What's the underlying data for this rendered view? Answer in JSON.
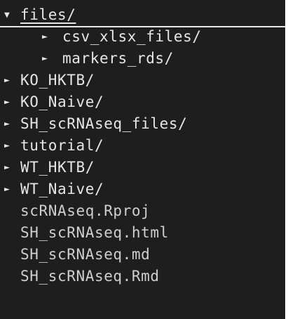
{
  "tree": {
    "root": {
      "caret": "▼",
      "label": "files/"
    },
    "subfolders": [
      {
        "caret": "►",
        "label": "csv_xlsx_files/"
      },
      {
        "caret": "►",
        "label": "markers_rds/"
      }
    ],
    "folders": [
      {
        "caret": "►",
        "label": "KO_HKTB/"
      },
      {
        "caret": "►",
        "label": "KO_Naive/"
      },
      {
        "caret": "►",
        "label": "SH_scRNAseq_files/"
      },
      {
        "caret": "►",
        "label": "tutorial/"
      },
      {
        "caret": "►",
        "label": "WT_HKTB/"
      },
      {
        "caret": "►",
        "label": "WT_Naive/"
      }
    ],
    "files": [
      {
        "label": "scRNAseq.Rproj"
      },
      {
        "label": "SH_scRNAseq.html"
      },
      {
        "label": "SH_scRNAseq.md"
      },
      {
        "label": "SH_scRNAseq.Rmd"
      }
    ]
  },
  "colors": {
    "background": "#1e1e1e",
    "text": "#e6e6e6",
    "file_text": "#cfcfcf"
  }
}
